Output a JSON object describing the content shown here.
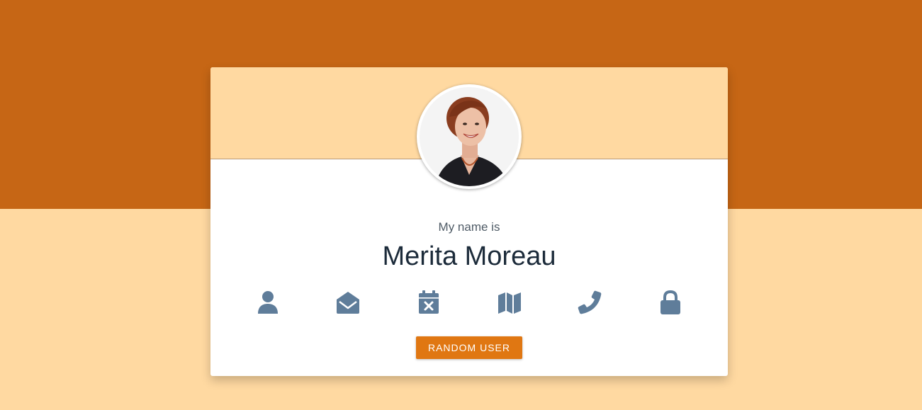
{
  "colors": {
    "top_band": "#C66615",
    "background": "#FFD9A1",
    "card": "#FFFFFF",
    "icon": "#5F7D9A",
    "button": "#E07712",
    "button_text": "#FFFFFF",
    "name_text": "#1C2B3A"
  },
  "profile": {
    "avatar_alt": "user-portrait",
    "label": "My name is",
    "name": "Merita Moreau"
  },
  "icons": [
    {
      "name": "user-icon"
    },
    {
      "name": "envelope-open-icon"
    },
    {
      "name": "calendar-x-icon"
    },
    {
      "name": "map-icon"
    },
    {
      "name": "phone-icon"
    },
    {
      "name": "lock-icon"
    }
  ],
  "button": {
    "label": "RANDOM USER"
  }
}
